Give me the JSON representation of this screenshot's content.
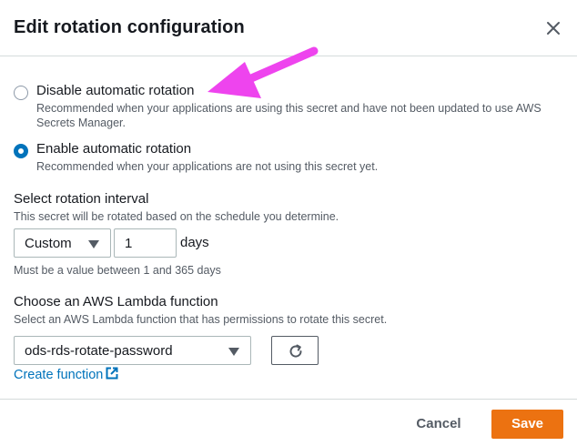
{
  "modal": {
    "title": "Edit rotation configuration",
    "close_icon": "close-icon"
  },
  "rotation": {
    "options": [
      {
        "label": "Disable automatic rotation",
        "description": "Recommended when your applications are using this secret and have not been updated to use AWS Secrets Manager.",
        "selected": false
      },
      {
        "label": "Enable automatic rotation",
        "description": "Recommended when your applications are not using this secret yet.",
        "selected": true
      }
    ]
  },
  "interval": {
    "label": "Select rotation interval",
    "description": "This secret will be rotated based on the schedule you determine.",
    "unit_select": "Custom",
    "value": "1",
    "units": "days",
    "constraint": "Must be a value between 1 and 365 days"
  },
  "lambda": {
    "label": "Choose an AWS Lambda function",
    "description": "Select an AWS Lambda function that has permissions to rotate this secret.",
    "selected_function": "ods-rds-rotate-password",
    "refresh_icon": "refresh-icon",
    "create_link": "Create function",
    "external_icon": "external-link-icon"
  },
  "footer": {
    "cancel_label": "Cancel",
    "save_label": "Save"
  },
  "colors": {
    "accent": "#0073bb",
    "primary_button": "#ec7211",
    "annotation_arrow": "#ee44ee"
  }
}
